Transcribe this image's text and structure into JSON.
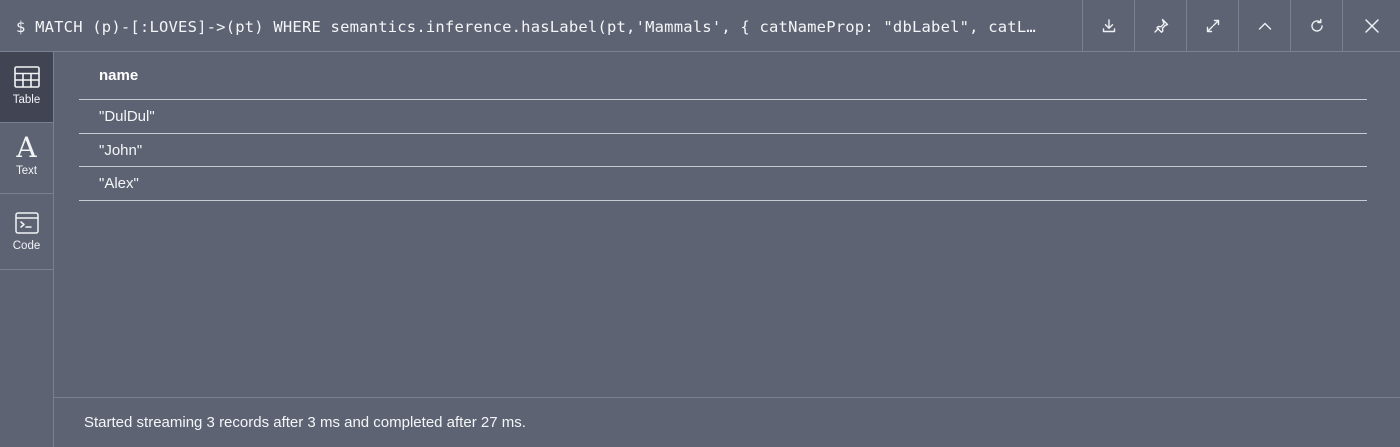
{
  "header": {
    "query": "$ MATCH (p)-[:LOVES]->(pt) WHERE semantics.inference.hasLabel(pt,'Mammals', { catNameProp: \"dbLabel\", catL…",
    "buttons": [
      {
        "name": "download-button",
        "icon": "download-icon"
      },
      {
        "name": "pin-button",
        "icon": "pin-icon"
      },
      {
        "name": "fullscreen-button",
        "icon": "expand-icon"
      },
      {
        "name": "collapse-button",
        "icon": "chevron-up-icon"
      },
      {
        "name": "rerun-button",
        "icon": "refresh-icon"
      },
      {
        "name": "close-button",
        "icon": "close-icon"
      }
    ]
  },
  "sidebar": {
    "items": [
      {
        "label": "Table",
        "icon": "table-icon",
        "active": true
      },
      {
        "label": "Text",
        "icon": "text-icon",
        "glyph": "A",
        "active": false
      },
      {
        "label": "Code",
        "icon": "code-icon",
        "active": false
      }
    ]
  },
  "table": {
    "columns": [
      "name"
    ],
    "rows": [
      "\"DulDul\"",
      "\"John\"",
      "\"Alex\""
    ]
  },
  "footer": {
    "status": "Started streaming 3 records after 3 ms and completed after 27 ms."
  },
  "colors": {
    "background": "#5d6373",
    "active_rail": "#414553",
    "divider": "#7b8090",
    "text": "#ffffff"
  }
}
